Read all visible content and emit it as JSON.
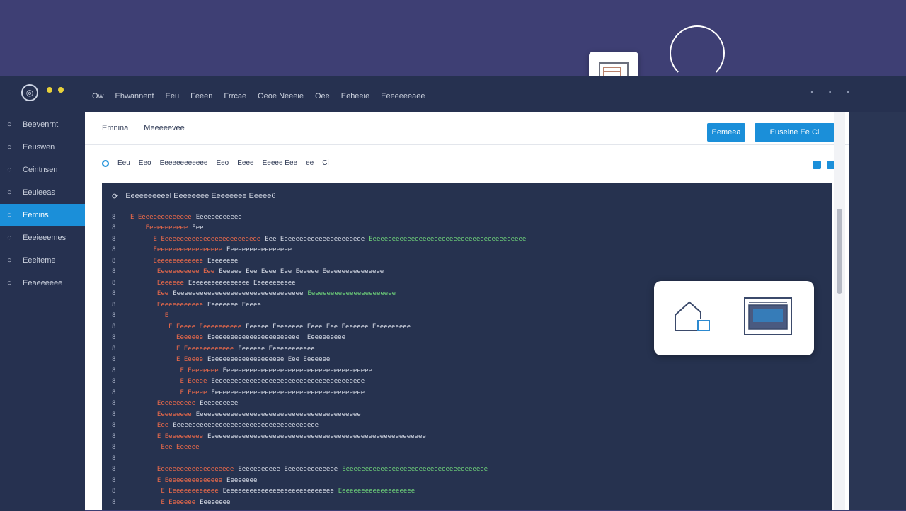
{
  "titlebar": {
    "menu": [
      "Ow",
      "Ehwannent",
      "Eeu",
      "Feeen",
      "Frrcae",
      "Oeoe Neeeie",
      "Oee",
      "Eeheeie",
      "Eeeeeeeaee"
    ]
  },
  "sidebar": {
    "items": [
      {
        "label": "Beevenrnt",
        "icon": "circle-icon"
      },
      {
        "label": "Eeuswen",
        "icon": "circle-icon"
      },
      {
        "label": "Ceintnsen",
        "icon": "circle-icon"
      },
      {
        "label": "Eeuieeas",
        "icon": "circle-icon"
      },
      {
        "label": "Eemins",
        "icon": "circle-icon",
        "active": true
      },
      {
        "label": "Eeeieeemes",
        "icon": "circle-icon"
      },
      {
        "label": "Eeeiteme",
        "icon": "circle-icon"
      },
      {
        "label": "Eeaeeeeee",
        "icon": "circle-icon"
      }
    ]
  },
  "content": {
    "breadcrumb": [
      "Emnina",
      "Meeeeevee"
    ],
    "buttons": {
      "primary1": "Eemeea",
      "primary2": "Euseine  Ee Ci"
    },
    "toolbar": [
      "Eeu",
      "Eeo",
      "Eeeeeeeeeeee",
      "Eeo",
      "Eeee",
      "Eeeee Eee",
      "ee",
      "Ci"
    ],
    "code_title": "Eeeeeeeeeel Eeeeeeee Eeeeeeee Eeeee6"
  },
  "code_lines": [
    {
      "n": "8",
      "kw": "E Eeeeeeeeeeeeee",
      "tx": "Eeeeeeeeeeee",
      "st": ""
    },
    {
      "n": "8",
      "kw": "    Eeeeeeeeeee",
      "tx": "Eee",
      "st": ""
    },
    {
      "n": "8",
      "kw": "      E Eeeeeeeeeeeeeeeeeeeeeeeeee",
      "tx": "Eee Eeeeeeeeeeeeeeeeeeeeee",
      "st": "Eeeeeeeeeeeeeeeeeeeeeeeeeeeeeeeeeeeeeeeee"
    },
    {
      "n": "8",
      "kw": "      Eeeeeeeeeeeeeeeeee",
      "tx": "Eeeeeeeeeeeeeeeee",
      "st": ""
    },
    {
      "n": "8",
      "kw": "      Eeeeeeeeeeeee",
      "tx": "Eeeeeeee",
      "st": ""
    },
    {
      "n": "8",
      "kw": "       Eeeeeeeeeee Eee",
      "tx": "Eeeeee Eee Eeee Eee Eeeeee Eeeeeeeeeeeeeeee",
      "st": ""
    },
    {
      "n": "8",
      "kw": "       Eeeeeee",
      "tx": "Eeeeeeeeeeeeeeee Eeeeeeeeeee",
      "st": ""
    },
    {
      "n": "8",
      "kw": "       Eee",
      "tx": "Eeeeeeeeeeeeeeeeeeeeeeeeeeeeeeeeee",
      "st": "Eeeeeeeeeeeeeeeeeeeeeee"
    },
    {
      "n": "8",
      "kw": "       Eeeeeeeeeeee",
      "tx": "Eeeeeeee Eeeee",
      "st": ""
    },
    {
      "n": "8",
      "kw": "         E",
      "tx": "",
      "st": ""
    },
    {
      "n": "8",
      "kw": "          E Eeeee Eeeeeeeeeee",
      "tx": "Eeeeee Eeeeeeee Eeee Eee Eeeeeee Eeeeeeeeee",
      "st": ""
    },
    {
      "n": "8",
      "kw": "            Eeeeeee",
      "tx": "Eeeeeeeeeeeeeeeeeeeeeeee  Eeeeeeeeee",
      "st": ""
    },
    {
      "n": "8",
      "kw": "            E Eeeeeeeeeeeee",
      "tx": "Eeeeeee Eeeeeeeeeeee",
      "st": ""
    },
    {
      "n": "8",
      "kw": "            E Eeeee",
      "tx": "Eeeeeeeeeeeeeeeeeeee Eee Eeeeeee",
      "st": ""
    },
    {
      "n": "8",
      "kw": "             E Eeeeeeee",
      "tx": "Eeeeeeeeeeeeeeeeeeeeeeeeeeeeeeeeeeeeeee",
      "st": ""
    },
    {
      "n": "8",
      "kw": "             E Eeeee",
      "tx": "Eeeeeeeeeeeeeeeeeeeeeeeeeeeeeeeeeeeeeeee",
      "st": ""
    },
    {
      "n": "8",
      "kw": "             E Eeeee",
      "tx": "Eeeeeeeeeeeeeeeeeeeeeeeeeeeeeeeeeeeeeeee",
      "st": ""
    },
    {
      "n": "8",
      "kw": "       Eeeeeeeeee",
      "tx": "Eeeeeeeeee",
      "st": ""
    },
    {
      "n": "8",
      "kw": "       Eeeeeeeee",
      "tx": "Eeeeeeeeeeeeeeeeeeeeeeeeeeeeeeeeeeeeeeeeeee",
      "st": ""
    },
    {
      "n": "8",
      "kw": "       Eee",
      "tx": "Eeeeeeeeeeeeeeeeeeeeeeeeeeeeeeeeeeeeee",
      "st": ""
    },
    {
      "n": "8",
      "kw": "       E Eeeeeeeeee",
      "tx": "Eeeeeeeeeeeeeeeeeeeeeeeeeeeeeeeeeeeeeeeeeeeeeeeeeeeeeeeee",
      "st": ""
    },
    {
      "n": "8",
      "kw": "        Eee Eeeeee",
      "tx": "",
      "st": ""
    },
    {
      "n": "8",
      "kw": "",
      "tx": "",
      "st": ""
    },
    {
      "n": "8",
      "kw": "       Eeeeeeeeeeeeeeeeeeee",
      "tx": "Eeeeeeeeeee Eeeeeeeeeeeeee",
      "st": "Eeeeeeeeeeeeeeeeeeeeeeeeeeeeeeeeeeeeee"
    },
    {
      "n": "8",
      "kw": "       E Eeeeeeeeeeeeeee",
      "tx": "Eeeeeeee",
      "st": ""
    },
    {
      "n": "8",
      "kw": "        E Eeeeeeeeeeeee",
      "tx": "Eeeeeeeeeeeeeeeeeeeeeeeeeeeee",
      "st": "Eeeeeeeeeeeeeeeeeeee"
    },
    {
      "n": "8",
      "kw": "        E Eeeeeee",
      "tx": "Eeeeeeee",
      "st": ""
    }
  ],
  "colors": {
    "accent": "#1b8fd9",
    "sidebar_bg": "#263150",
    "code_bg": "#26324f",
    "keyword": "#ef6b4a",
    "string": "#6fd37a"
  },
  "icons": {
    "floating_tile": "window-icon",
    "card_left": "home-icon",
    "card_right": "monitor-icon"
  }
}
